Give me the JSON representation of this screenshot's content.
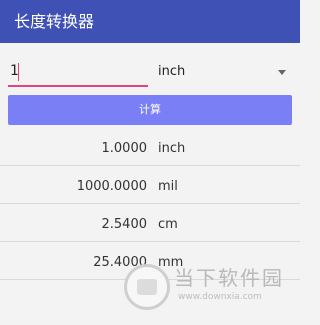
{
  "appbar": {
    "title": "长度转换器"
  },
  "input": {
    "value": "1"
  },
  "unit_select": {
    "selected": "inch"
  },
  "calc_button": {
    "label": "计算"
  },
  "results": [
    {
      "value": "1.0000",
      "unit": "inch"
    },
    {
      "value": "1000.0000",
      "unit": "mil"
    },
    {
      "value": "2.5400",
      "unit": "cm"
    },
    {
      "value": "25.4000",
      "unit": "mm"
    }
  ],
  "watermark": {
    "title": "当下软件园",
    "url": "www.downxia.com"
  },
  "colors": {
    "appbar": "#3f51b5",
    "accent": "#e0457b",
    "button": "#7b7ff5"
  }
}
